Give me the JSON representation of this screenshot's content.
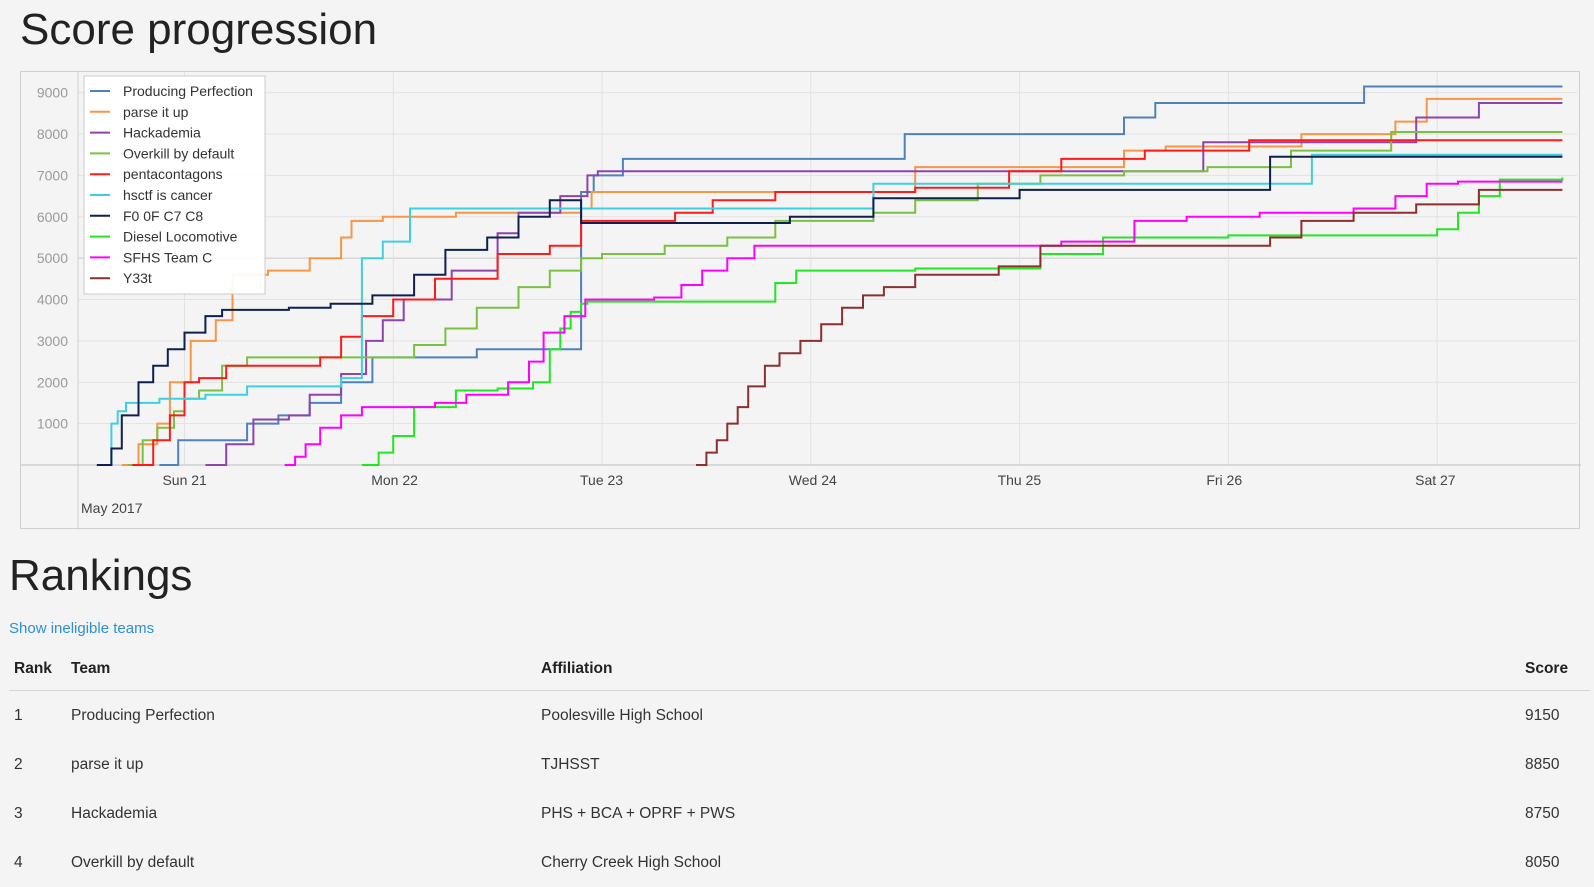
{
  "page": {
    "score_title": "Score progression",
    "rankings_title": "Rankings",
    "ineligible_link": "Show ineligible teams"
  },
  "table": {
    "headers": [
      "Rank",
      "Team",
      "Affiliation",
      "Score"
    ],
    "rows": [
      [
        "1",
        "Producing Perfection",
        "Poolesville High School",
        "9150"
      ],
      [
        "2",
        "parse it up",
        "TJHSST",
        "8850"
      ],
      [
        "3",
        "Hackademia",
        "PHS + BCA + OPRF + PWS",
        "8750"
      ],
      [
        "4",
        "Overkill by default",
        "Cherry Creek High School",
        "8050"
      ]
    ]
  },
  "chart_data": {
    "type": "line",
    "title": "",
    "xlabel": "",
    "ylabel": "",
    "x_axis": "day",
    "x_ticks": [
      {
        "x": 1,
        "label": "Sun 21"
      },
      {
        "x": 2,
        "label": "Mon 22"
      },
      {
        "x": 3,
        "label": "Tue 23"
      },
      {
        "x": 4,
        "label": "Wed 24"
      },
      {
        "x": 5,
        "label": "Thu 25"
      },
      {
        "x": 6,
        "label": "Fri 26"
      },
      {
        "x": 7,
        "label": "Sat 27"
      }
    ],
    "x_sublabel": "May 2017",
    "xlim": [
      0.49,
      7.67
    ],
    "ylim": [
      0,
      9500
    ],
    "y_ticks": [
      1000,
      2000,
      3000,
      4000,
      5000,
      6000,
      7000,
      8000,
      9000
    ],
    "grid": true,
    "legend": "top-left",
    "series": [
      {
        "name": "Producing Perfection",
        "color": "#4f81bd",
        "x": [
          0.88,
          0.97,
          1.3,
          1.45,
          1.6,
          1.75,
          1.9,
          2.4,
          2.83,
          2.9,
          2.96,
          3.1,
          4.25,
          4.45,
          5.5,
          5.65,
          5.8,
          6.1,
          6.65,
          7.6
        ],
        "y": [
          0,
          600,
          1000,
          1200,
          1500,
          2000,
          2600,
          2800,
          2800,
          6600,
          7000,
          7400,
          7400,
          8000,
          8400,
          8750,
          8750,
          8750,
          9150,
          9150
        ]
      },
      {
        "name": "parse it up",
        "color": "#f79646",
        "x": [
          0.7,
          0.78,
          0.87,
          0.93,
          1.03,
          1.15,
          1.23,
          1.4,
          1.6,
          1.75,
          1.8,
          1.95,
          2.3,
          2.9,
          2.95,
          4.33,
          4.5,
          5.5,
          5.7,
          5.98,
          6.35,
          6.8,
          6.95,
          7.6
        ],
        "y": [
          0,
          500,
          1000,
          2000,
          3000,
          3500,
          4600,
          4700,
          5000,
          5500,
          5900,
          6000,
          6100,
          6200,
          6600,
          6600,
          7200,
          7600,
          7700,
          7700,
          8000,
          8300,
          8850,
          8850
        ]
      },
      {
        "name": "Hackademia",
        "color": "#8e44ad",
        "x": [
          1.1,
          1.2,
          1.33,
          1.5,
          1.6,
          1.75,
          1.87,
          1.95,
          2.05,
          2.28,
          2.5,
          2.6,
          2.8,
          2.93,
          2.98,
          3.05,
          4.3,
          5.7,
          5.88,
          6.45,
          6.65,
          6.9,
          7.2,
          7.6
        ],
        "y": [
          0,
          500,
          1100,
          1200,
          1700,
          2200,
          3000,
          3500,
          4000,
          4700,
          5600,
          6100,
          6500,
          7000,
          7100,
          7100,
          7100,
          7100,
          7800,
          7800,
          7800,
          8400,
          8750,
          8750
        ]
      },
      {
        "name": "Overkill by default",
        "color": "#7ac143",
        "x": [
          0.73,
          0.8,
          0.87,
          0.95,
          1.0,
          1.07,
          1.18,
          1.3,
          1.9,
          2.1,
          2.25,
          2.4,
          2.6,
          2.75,
          2.9,
          3.0,
          3.3,
          3.6,
          3.83,
          4.3,
          4.5,
          4.8,
          5.1,
          5.5,
          5.9,
          6.3,
          6.78,
          7.6
        ],
        "y": [
          0,
          600,
          900,
          1300,
          1600,
          1800,
          2400,
          2600,
          2600,
          2900,
          3300,
          3800,
          4300,
          4700,
          5000,
          5100,
          5300,
          5500,
          5900,
          6100,
          6400,
          6800,
          7000,
          7100,
          7200,
          7600,
          8050,
          8050
        ]
      },
      {
        "name": "pentacontagons",
        "color": "#ff1a1a",
        "x": [
          0.75,
          0.85,
          0.93,
          1.0,
          1.07,
          1.2,
          1.65,
          1.75,
          1.85,
          2.0,
          2.2,
          2.5,
          2.75,
          2.9,
          3.0,
          3.35,
          3.53,
          3.83,
          4.5,
          4.95,
          5.2,
          5.6,
          5.8,
          6.1,
          6.6,
          7.6
        ],
        "y": [
          0,
          600,
          1200,
          2000,
          2100,
          2400,
          2600,
          3100,
          3600,
          4000,
          4500,
          5100,
          5300,
          5900,
          5900,
          6100,
          6400,
          6600,
          6700,
          7100,
          7400,
          7600,
          7600,
          7850,
          7850,
          7850
        ]
      },
      {
        "name": "hsctf is cancer",
        "color": "#3fd0e0",
        "x": [
          0.6,
          0.65,
          0.68,
          0.72,
          0.78,
          0.88,
          1.0,
          1.1,
          1.3,
          1.75,
          1.85,
          1.95,
          2.08,
          2.3,
          2.75,
          2.95,
          4.3,
          5.6,
          6.4,
          7.6
        ],
        "y": [
          0,
          1000,
          1300,
          1500,
          1500,
          1600,
          1600,
          1700,
          1900,
          2100,
          5000,
          5400,
          6200,
          6200,
          6200,
          6200,
          6800,
          6800,
          7500,
          7500
        ]
      },
      {
        "name": "F0 0F C7 C8",
        "color": "#0f1f4f",
        "x": [
          0.58,
          0.65,
          0.7,
          0.78,
          0.85,
          0.92,
          1.0,
          1.1,
          1.18,
          1.3,
          1.5,
          1.7,
          1.9,
          2.1,
          2.25,
          2.45,
          2.6,
          2.75,
          2.9,
          3.1,
          3.3,
          3.55,
          3.9,
          4.3,
          4.7,
          5.0,
          5.4,
          5.8,
          6.2,
          7.6
        ],
        "y": [
          0,
          400,
          1200,
          2000,
          2400,
          2800,
          3200,
          3600,
          3750,
          3750,
          3800,
          3900,
          4100,
          4600,
          5200,
          5500,
          6000,
          6400,
          5850,
          5850,
          5850,
          5850,
          6000,
          6450,
          6450,
          6650,
          6650,
          6650,
          7450,
          7450
        ]
      },
      {
        "name": "Diesel Locomotive",
        "color": "#22e622",
        "x": [
          1.85,
          1.93,
          2.0,
          2.1,
          2.3,
          2.5,
          2.67,
          2.75,
          2.8,
          2.85,
          2.9,
          2.93,
          3.3,
          3.6,
          3.83,
          3.93,
          4.1,
          4.5,
          5.1,
          5.4,
          5.7,
          6.0,
          6.35,
          6.7,
          7.0,
          7.1,
          7.2,
          7.3,
          7.6
        ],
        "y": [
          0,
          300,
          700,
          1400,
          1800,
          1850,
          2000,
          2800,
          3300,
          3700,
          3900,
          3950,
          3950,
          3950,
          4400,
          4700,
          4700,
          4750,
          5100,
          5500,
          5500,
          5550,
          5550,
          5550,
          5700,
          6100,
          6500,
          6900,
          6950
        ]
      },
      {
        "name": "SFHS Team C",
        "color": "#ff00ff",
        "x": [
          1.48,
          1.53,
          1.58,
          1.65,
          1.75,
          1.85,
          2.2,
          2.35,
          2.55,
          2.65,
          2.72,
          2.82,
          2.92,
          3.25,
          3.38,
          3.48,
          3.6,
          3.73,
          3.85,
          4.3,
          5.2,
          5.55,
          5.8,
          6.15,
          6.6,
          6.8,
          6.95,
          7.1,
          7.6
        ],
        "y": [
          0,
          200,
          500,
          900,
          1200,
          1400,
          1500,
          1700,
          2000,
          2500,
          3200,
          3600,
          4000,
          4050,
          4350,
          4700,
          5000,
          5300,
          5300,
          5300,
          5400,
          5900,
          6000,
          6100,
          6200,
          6500,
          6800,
          6850,
          6850
        ]
      },
      {
        "name": "Y33t",
        "color": "#8b2f2f",
        "x": [
          3.45,
          3.5,
          3.55,
          3.6,
          3.65,
          3.7,
          3.78,
          3.85,
          3.95,
          4.05,
          4.15,
          4.25,
          4.35,
          4.5,
          4.9,
          5.1,
          5.5,
          5.9,
          6.2,
          6.35,
          6.6,
          6.9,
          7.2,
          7.6
        ],
        "y": [
          0,
          300,
          600,
          1000,
          1400,
          1900,
          2400,
          2700,
          3000,
          3400,
          3800,
          4100,
          4300,
          4600,
          4800,
          5300,
          5300,
          5300,
          5500,
          5900,
          6100,
          6300,
          6650,
          6650
        ]
      }
    ]
  }
}
